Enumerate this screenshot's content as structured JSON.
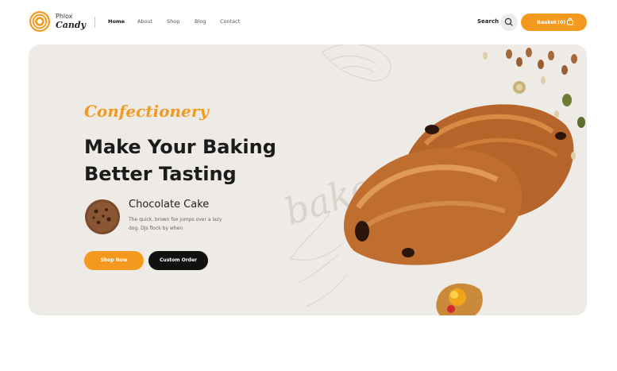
{
  "brand": {
    "name_top": "Phlox",
    "name_bottom": "Candy",
    "accent": "#f39a1e"
  },
  "nav": {
    "items": [
      {
        "label": "Home",
        "active": true
      },
      {
        "label": "About",
        "active": false
      },
      {
        "label": "Shop",
        "active": false
      },
      {
        "label": "Blog",
        "active": false
      },
      {
        "label": "Contact",
        "active": false
      }
    ]
  },
  "header_actions": {
    "search_label": "Search",
    "basket_label": "Basket",
    "basket_count": "(0)"
  },
  "hero": {
    "eyebrow": "Confectionery",
    "headline": "Make Your Baking Better Tasting",
    "product": {
      "name": "Chocolate Cake",
      "description": "The quick, brown fox jumps over a lazy dog. DJs flock by when"
    },
    "primary_button": "Shop Now",
    "secondary_button": "Custom Order",
    "watermark": "bake with love"
  },
  "colors": {
    "accent": "#f39a1e",
    "hero_bg": "#eeebe7",
    "dark": "#111111"
  }
}
